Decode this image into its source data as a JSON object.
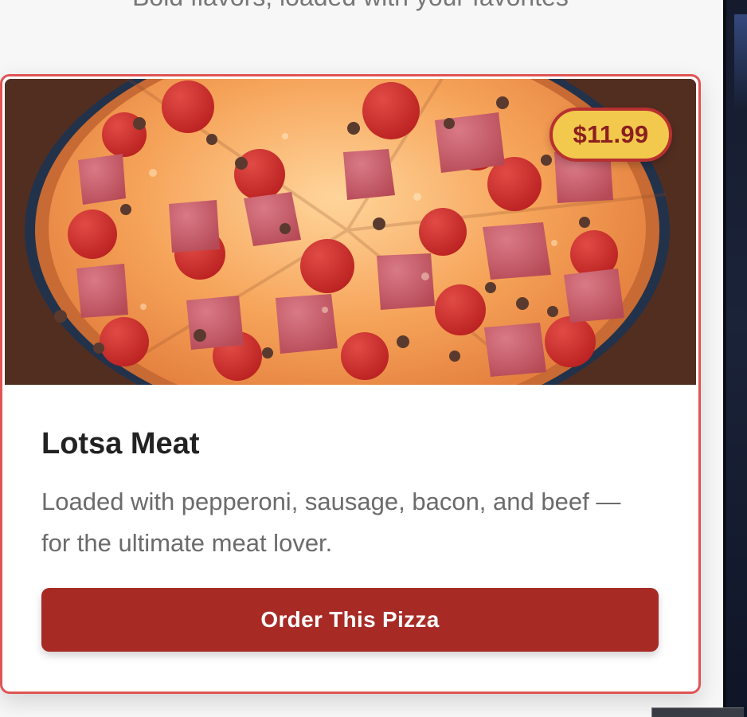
{
  "page": {
    "subtitle": "Bold flavors, loaded with your favorites"
  },
  "card": {
    "name": "Lotsa Meat",
    "price": "$11.99",
    "description": "Loaded with pepperoni, sausage, bacon, and beef — for the ultimate meat lover.",
    "button_label": "Order This Pizza",
    "image": "pizza-photo"
  },
  "colors": {
    "accent": "#a72a25",
    "card_border": "#e05454",
    "badge_bg": "#f2c94c",
    "badge_text": "#8b1f1f",
    "title_text": "#222222",
    "description_text": "#6b6b6b"
  }
}
